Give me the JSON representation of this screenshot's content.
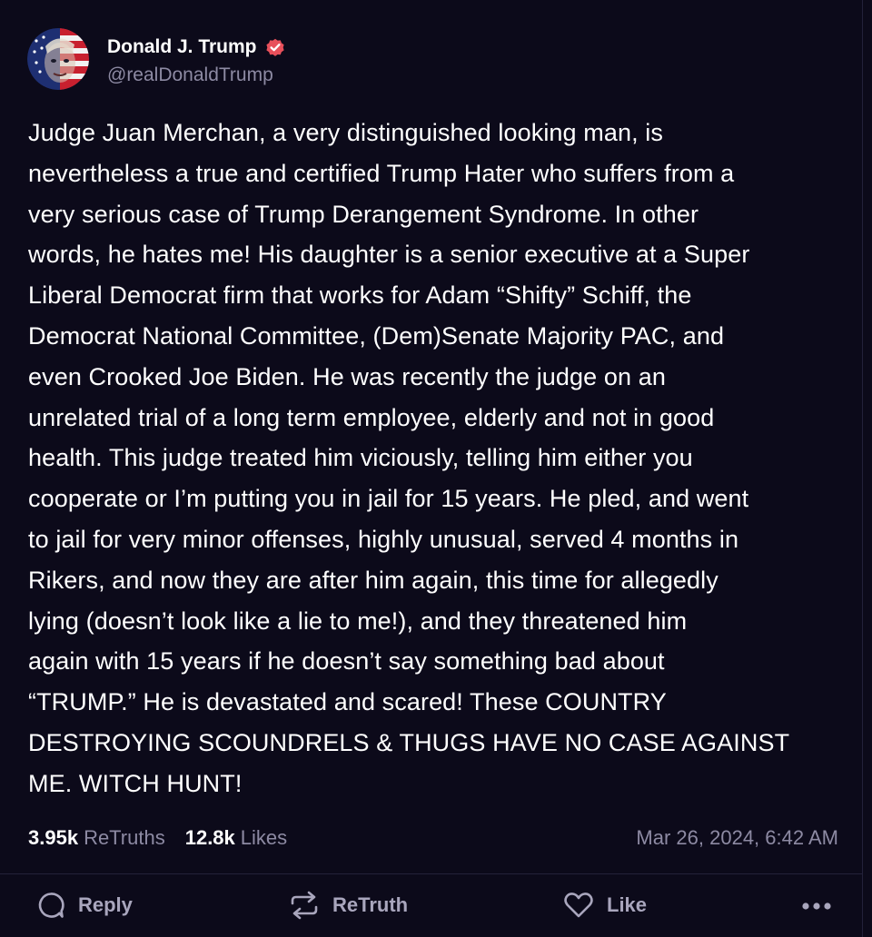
{
  "author": {
    "display_name": "Donald J. Trump",
    "handle": "@realDonaldTrump",
    "avatar_icon": "avatar-flag-portrait",
    "verified_icon": "verified-badge-icon",
    "verified_color": "#e8505b"
  },
  "post": {
    "lines": [
      "Judge Juan Merchan, a very distinguished looking man, is",
      "nevertheless a true and certified Trump Hater who suffers  from a",
      "very serious case of Trump Derangement Syndrome. In other",
      "words, he hates me! His daughter is a senior executive at a Super",
      "Liberal Democrat firm that works for Adam “Shifty” Schiff, the",
      "Democrat National Committee, (Dem)Senate Majority PAC, and",
      "even Crooked Joe Biden. He was recently the judge on an",
      "unrelated trial of a long term employee, elderly and not in good",
      "health. This judge treated him viciously, telling him either you",
      "cooperate or I’m putting you in jail for 15 years. He pled, and went",
      "to jail for very minor offenses, highly unusual, served 4 months in",
      "Rikers, and now they are after him again, this time for allegedly",
      "lying (doesn’t look like a lie to me!), and they threatened him",
      "again with 15 years if he doesn’t say something bad about",
      "“TRUMP.” He is devastated and scared! These COUNTRY",
      "DESTROYING SCOUNDRELS & THUGS HAVE NO CASE AGAINST",
      "ME. WITCH HUNT!"
    ]
  },
  "stats": {
    "retruths_count": "3.95k",
    "retruths_label": "ReTruths",
    "likes_count": "12.8k",
    "likes_label": "Likes",
    "timestamp": "Mar 26, 2024, 6:42 AM"
  },
  "actions": {
    "reply_label": "Reply",
    "retruth_label": "ReTruth",
    "like_label": "Like",
    "reply_icon": "reply-icon",
    "retruth_icon": "retruth-icon",
    "like_icon": "heart-icon",
    "more_icon": "more-options-icon"
  },
  "colors": {
    "background": "#0c0a1a",
    "text": "#ffffff",
    "muted": "#8d8aa3",
    "divider": "#23213a"
  }
}
